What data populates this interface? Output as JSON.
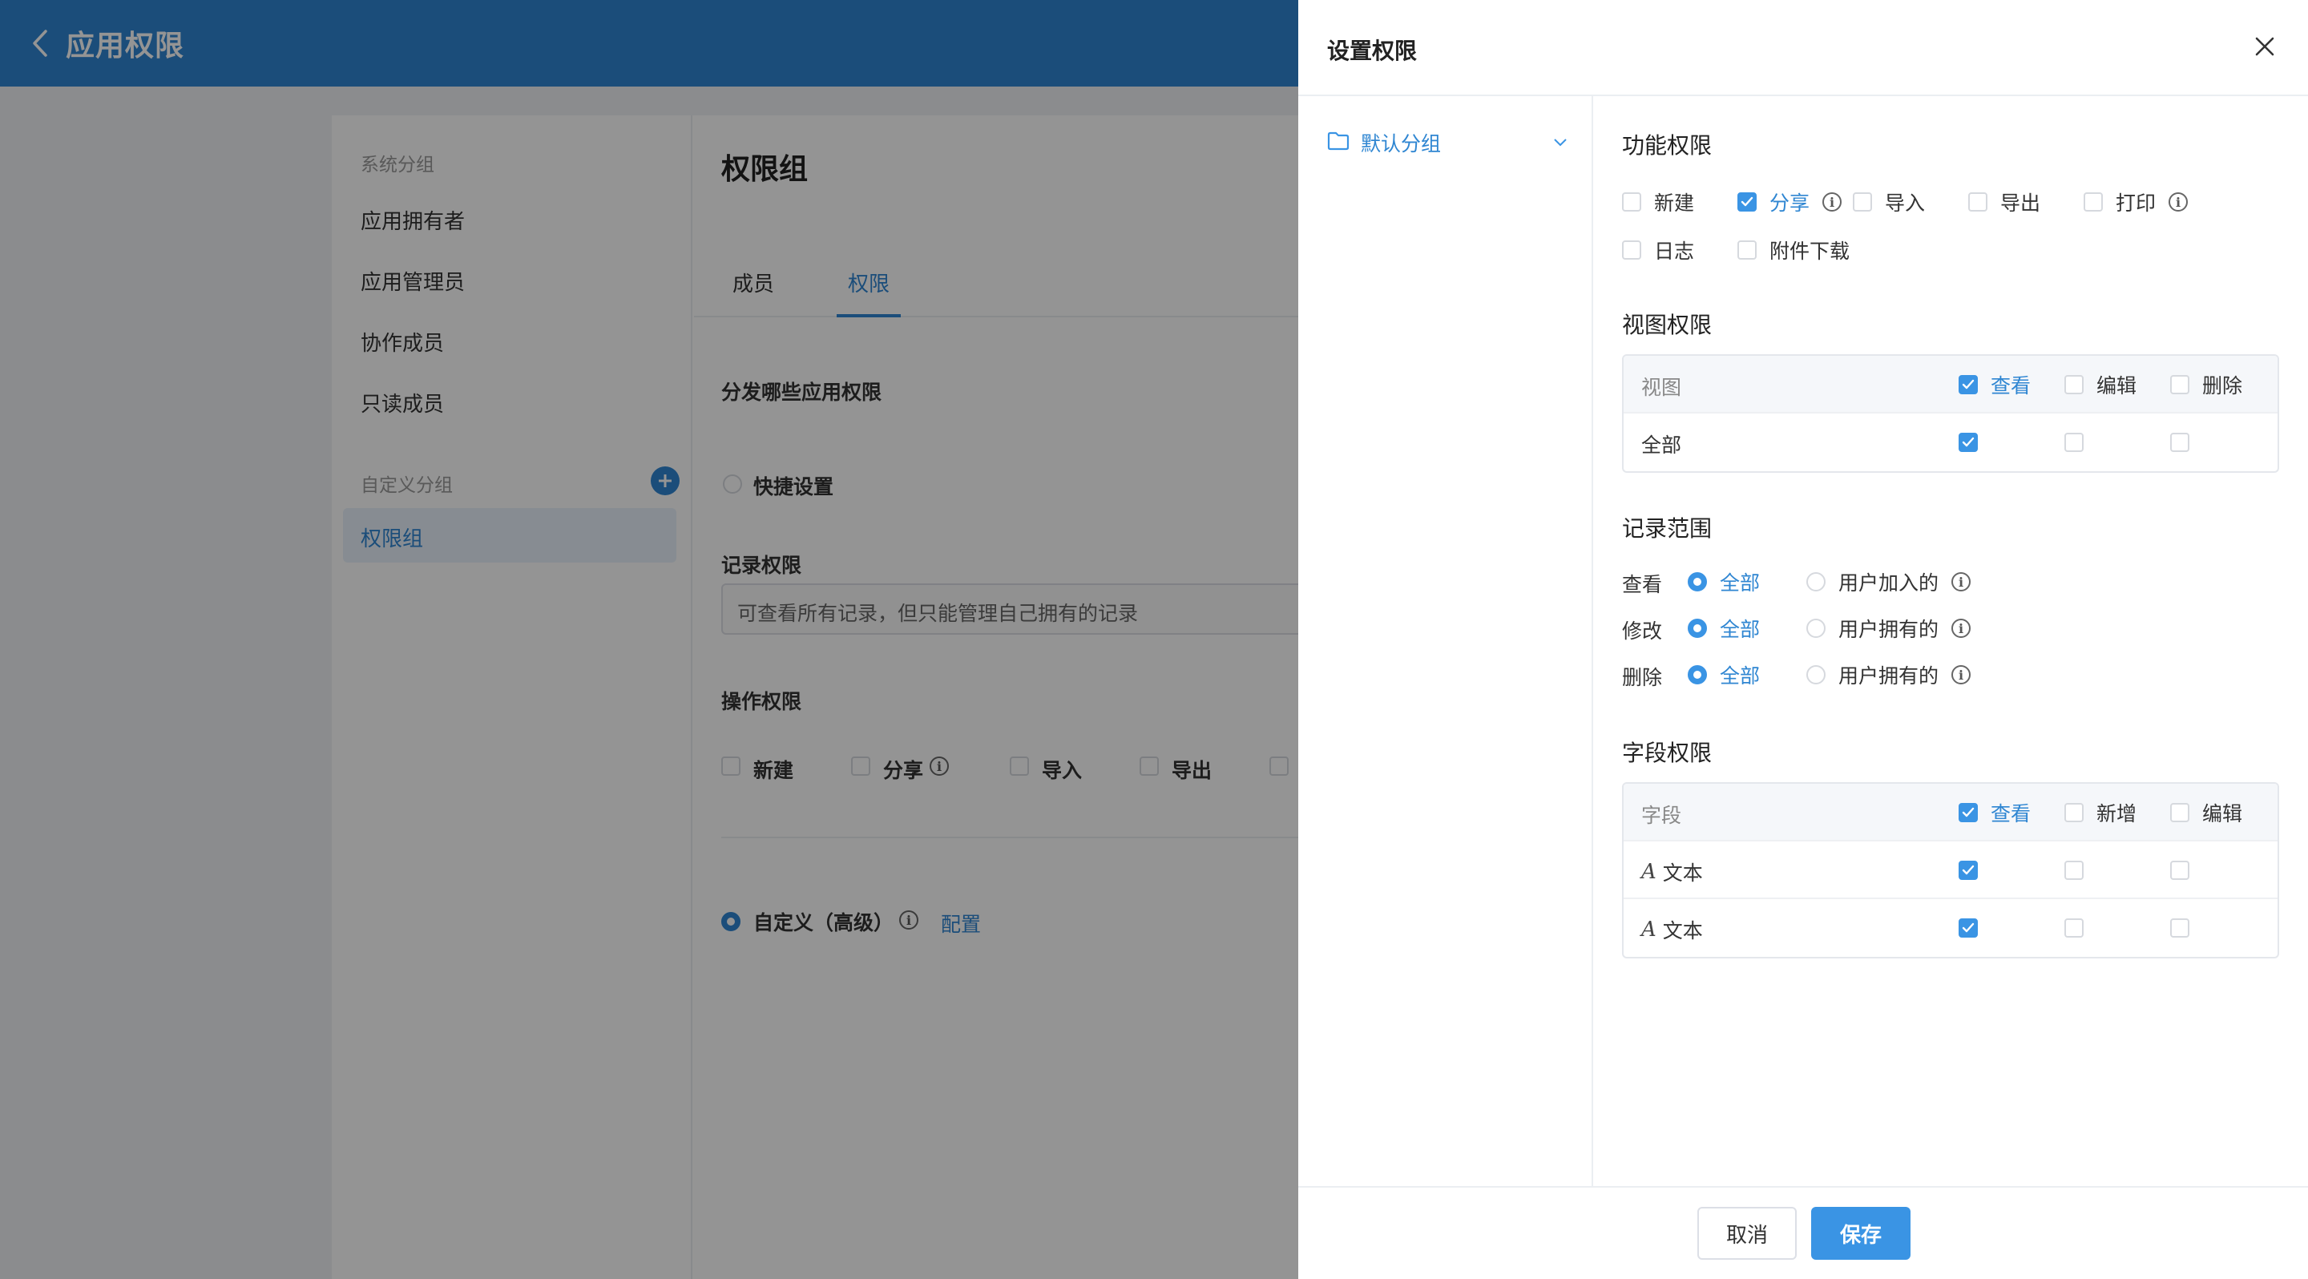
{
  "app": {
    "title": "应用权限"
  },
  "groups": {
    "system_title": "系统分组",
    "system_items": [
      "应用拥有者",
      "应用管理员",
      "协作成员",
      "只读成员"
    ],
    "custom_title": "自定义分组",
    "custom_items": [
      "权限组"
    ]
  },
  "main": {
    "title": "权限组",
    "tabs": [
      "成员",
      "权限"
    ],
    "active_tab": "权限",
    "dispatch_label": "分发哪些应用权限",
    "quick_setting": "快捷设置",
    "record_label": "记录权限",
    "record_value": "可查看所有记录，但只能管理自己拥有的记录",
    "op_label": "操作权限",
    "op_items": [
      "新建",
      "分享",
      "导入",
      "导出"
    ],
    "custom_advanced": "自定义（高级）",
    "config_link": "配置"
  },
  "drawer": {
    "title": "设置权限",
    "folder": "默认分组",
    "feature": {
      "title": "功能权限",
      "items": [
        {
          "label": "新建",
          "checked": false,
          "info": false
        },
        {
          "label": "分享",
          "checked": true,
          "info": true
        },
        {
          "label": "导入",
          "checked": false,
          "info": false
        },
        {
          "label": "导出",
          "checked": false,
          "info": false
        },
        {
          "label": "打印",
          "checked": false,
          "info": true
        },
        {
          "label": "日志",
          "checked": false,
          "info": false
        },
        {
          "label": "附件下载",
          "checked": false,
          "info": false
        }
      ]
    },
    "view": {
      "title": "视图权限",
      "head": "视图",
      "cols": [
        {
          "label": "查看",
          "checked": true
        },
        {
          "label": "编辑",
          "checked": false
        },
        {
          "label": "删除",
          "checked": false
        }
      ],
      "rows": [
        {
          "name": "全部",
          "values": [
            true,
            false,
            false
          ]
        }
      ]
    },
    "range": {
      "title": "记录范围",
      "rows": [
        {
          "label": "查看",
          "all": "全部",
          "other": "用户加入的"
        },
        {
          "label": "修改",
          "all": "全部",
          "other": "用户拥有的"
        },
        {
          "label": "删除",
          "all": "全部",
          "other": "用户拥有的"
        }
      ]
    },
    "field": {
      "title": "字段权限",
      "head": "字段",
      "cols": [
        {
          "label": "查看",
          "checked": true
        },
        {
          "label": "新增",
          "checked": false
        },
        {
          "label": "编辑",
          "checked": false
        }
      ],
      "rows": [
        {
          "name": "文本",
          "values": [
            true,
            false,
            false
          ]
        },
        {
          "name": "文本",
          "values": [
            true,
            false,
            false
          ]
        }
      ]
    },
    "cancel": "取消",
    "save": "保存"
  },
  "colors": {
    "brand": "#2f86d2",
    "accent": "#3a94e4"
  }
}
